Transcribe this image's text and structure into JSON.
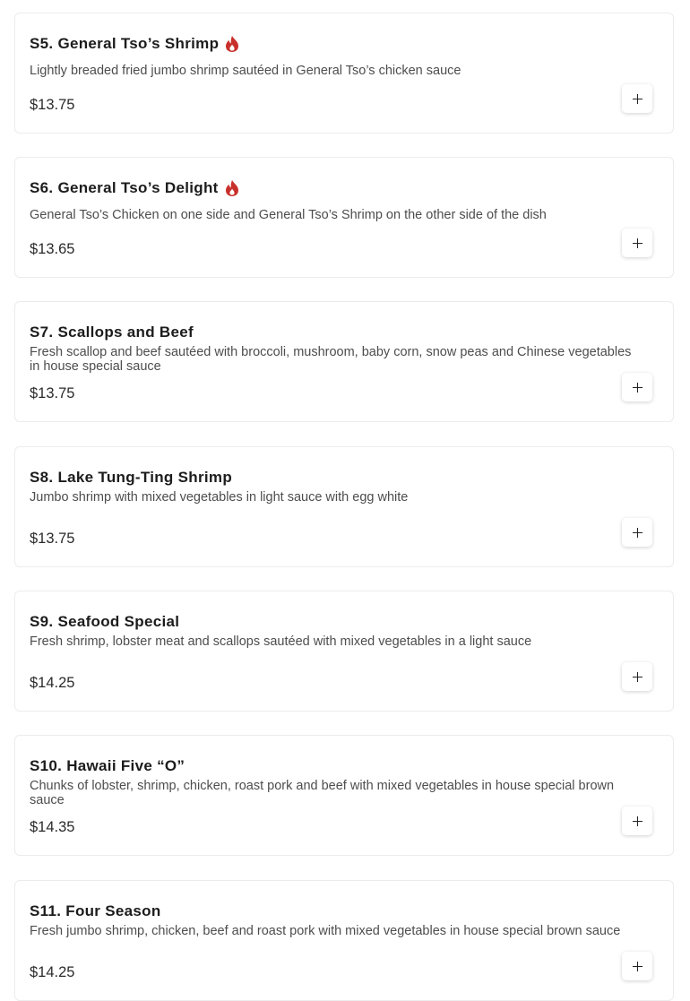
{
  "items": [
    {
      "title": "S5. General Tso’s Shrimp",
      "spicy": true,
      "description": "Lightly breaded fried jumbo shrimp sautéed in General Tso’s chicken sauce",
      "price": "$13.75"
    },
    {
      "title": "S6. General Tso’s Delight",
      "spicy": true,
      "description": "General Tso’s Chicken on one side and General Tso’s Shrimp on the other side of the dish",
      "price": "$13.65"
    },
    {
      "title": "S7. Scallops and Beef",
      "spicy": false,
      "description": "Fresh scallop and beef sautéed with broccoli, mushroom, baby corn, snow peas and Chinese vegetables in house special sauce",
      "price": "$13.75"
    },
    {
      "title": "S8. Lake Tung-Ting Shrimp",
      "spicy": false,
      "description": "Jumbo shrimp with mixed vegetables in light sauce with egg white",
      "price": "$13.75"
    },
    {
      "title": "S9. Seafood Special",
      "spicy": false,
      "description": "Fresh shrimp, lobster meat and scallops sautéed with mixed vegetables in a light sauce",
      "price": "$14.25"
    },
    {
      "title": "S10. Hawaii Five “O”",
      "spicy": false,
      "description": "Chunks of lobster, shrimp, chicken, roast pork and beef with mixed vegetables in house special brown sauce",
      "price": "$14.35"
    },
    {
      "title": "S11. Four Season",
      "spicy": false,
      "description": "Fresh jumbo shrimp, chicken, beef and roast pork with mixed vegetables in house special brown sauce",
      "price": "$14.25"
    }
  ],
  "icons": {
    "spicy": "fire-icon",
    "add": "plus-icon"
  },
  "colors": {
    "spicy": "#c8302b"
  }
}
